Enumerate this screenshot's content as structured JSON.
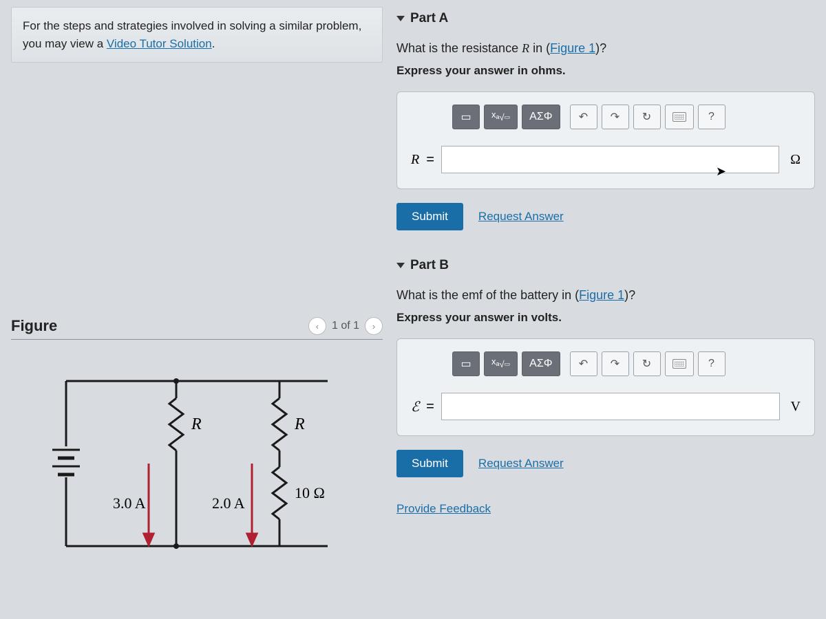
{
  "hint": {
    "prefix": "For the steps and strategies involved in solving a similar problem, you may view a ",
    "link": "Video Tutor Solution",
    "suffix": "."
  },
  "figure": {
    "title": "Figure",
    "pager": "1 of 1",
    "labels": {
      "r1": "R",
      "r2": "R",
      "i1": "3.0 A",
      "i2": "2.0 A",
      "r_fixed": "10 Ω"
    }
  },
  "partA": {
    "title": "Part A",
    "question_prefix": "What is the resistance ",
    "question_var": "R",
    "question_mid": " in (",
    "figure_link": "Figure 1",
    "question_suffix": ")?",
    "instruct": "Express your answer in ohms.",
    "var": "R",
    "eq": "=",
    "unit": "Ω",
    "submit": "Submit",
    "request": "Request Answer"
  },
  "partB": {
    "title": "Part B",
    "question_prefix": "What is the emf of the battery in (",
    "figure_link": "Figure 1",
    "question_suffix": ")?",
    "instruct": "Express your answer in volts.",
    "var": "ℰ",
    "eq": "=",
    "unit": "V",
    "submit": "Submit",
    "request": "Request Answer"
  },
  "toolbar": {
    "templates": "⬛",
    "fraction": "√",
    "greek": "ΑΣΦ",
    "undo": "↶",
    "redo": "↷",
    "reset": "↻",
    "keyboard": "kbd",
    "help": "?"
  },
  "feedback": "Provide Feedback"
}
